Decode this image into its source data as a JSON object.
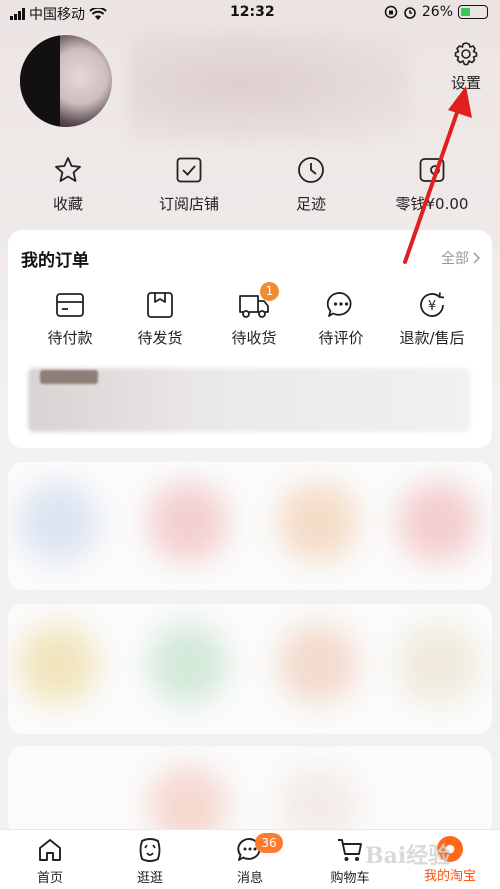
{
  "status_bar": {
    "carrier": "中国移动",
    "time": "12:32",
    "battery_percent": "26%"
  },
  "header": {
    "settings_label": "设置"
  },
  "quick_links": [
    {
      "label": "收藏",
      "icon": "star-icon"
    },
    {
      "label": "订阅店铺",
      "icon": "subscribe-shop-icon"
    },
    {
      "label": "足迹",
      "icon": "clock-icon"
    },
    {
      "label": "零钱¥0.00",
      "icon": "wallet-icon"
    }
  ],
  "orders": {
    "title": "我的订单",
    "all_label": "全部",
    "items": [
      {
        "label": "待付款",
        "icon": "card-icon"
      },
      {
        "label": "待发货",
        "icon": "box-icon"
      },
      {
        "label": "待收货",
        "icon": "truck-icon",
        "badge": "1"
      },
      {
        "label": "待评价",
        "icon": "chat-icon"
      },
      {
        "label": "退款/售后",
        "icon": "refund-icon"
      }
    ]
  },
  "tab_bar": {
    "items": [
      {
        "label": "首页",
        "icon": "home-icon"
      },
      {
        "label": "逛逛",
        "icon": "browse-icon"
      },
      {
        "label": "消息",
        "icon": "message-icon",
        "badge": "36"
      },
      {
        "label": "购物车",
        "icon": "cart-icon"
      },
      {
        "label": "我的淘宝",
        "icon": "my-taobao-icon",
        "active": true
      }
    ],
    "accent_color": "#ff5000"
  },
  "annotation_arrow_color": "#e02020",
  "watermark_text": "Bai经验"
}
